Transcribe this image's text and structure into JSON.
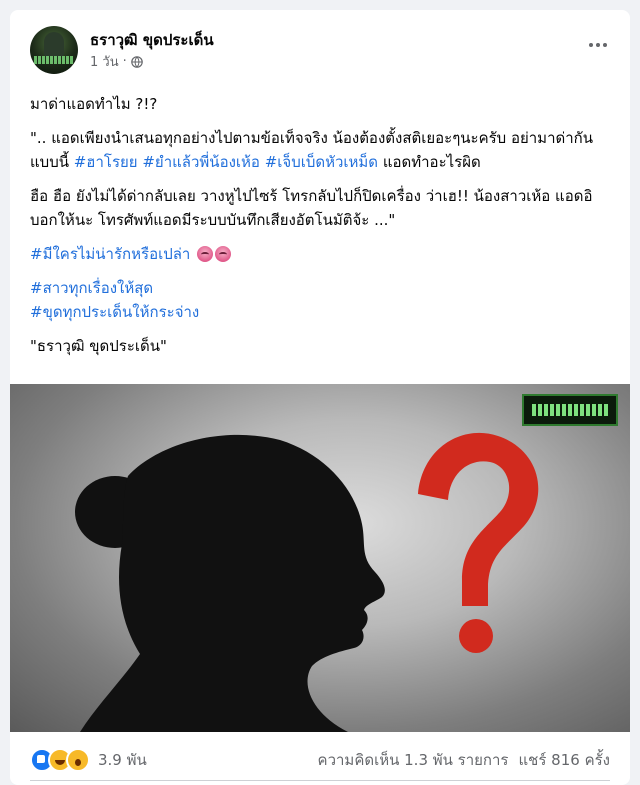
{
  "post": {
    "page_name": "ธราวุฒิ ขุดประเด็น",
    "timestamp": "1 วัน",
    "privacy_icon": "globe-icon",
    "more_icon": "more-horizontal-icon"
  },
  "content": {
    "line1": "มาด่าแอดทำไม ?!?",
    "para2_text": "\".. แอดเพียงนำเสนอทุกอย่างไปตามข้อเท็จจริง น้องต้องตั้งสติเยอะๆนะครับ อย่ามาด่ากันแบบนี้ ",
    "para2_tags": [
      "#ฮาโรยย",
      "#ยำแล้วพี่น้องเห้อ",
      "#เจ็บเบ็ดหัวเหม็ด"
    ],
    "para2_tail": " แอดทำอะไรผิด",
    "para3": "ฮือ ฮือ ยังไม่ได้ด่ากลับเลย วางหูไปไซร้ โทรกลับไปก็ปิดเครื่อง ว่าเฮ!! น้องสาวเห้อ แอดอิบอกให้นะ โทรศัพท์แอดมีระบบบันทึกเสียงอัตโนมัติจ้ะ  ...\"",
    "tag4": "#มีใครไม่น่ารักหรือเปล่า",
    "tag5": "#สาวทุกเรื่องให้สุด",
    "tag6": "#ขุดทุกประเด็นให้กระจ่าง",
    "signature": "\"ธราวุฒิ ขุดประเด็น\""
  },
  "image": {
    "description_icon": "silhouette-question-image",
    "watermark_icon": "page-logo-watermark"
  },
  "footer": {
    "reactions": [
      "like-icon",
      "haha-icon",
      "wow-icon"
    ],
    "reaction_count": "3.9 พัน",
    "comments": "ความคิดเห็น 1.3 พัน รายการ",
    "shares": "แชร์ 816 ครั้ง"
  },
  "colors": {
    "link": "#216fdb",
    "question_mark": "#d12a1e",
    "secondary_text": "#65676b"
  }
}
